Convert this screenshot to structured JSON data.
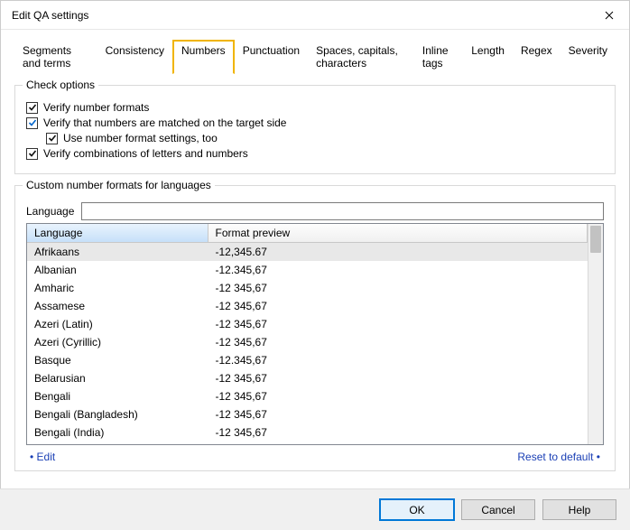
{
  "window": {
    "title": "Edit QA settings"
  },
  "tabs": {
    "items": [
      "Segments and terms",
      "Consistency",
      "Numbers",
      "Punctuation",
      "Spaces, capitals, characters",
      "Inline tags",
      "Length",
      "Regex",
      "Severity"
    ],
    "active_index": 2
  },
  "check_options": {
    "title": "Check options",
    "verify_number_formats": {
      "label": "Verify number formats",
      "checked": true,
      "color": "black"
    },
    "verify_numbers_matched": {
      "label": "Verify that numbers are matched on the target side",
      "checked": true,
      "color": "blue"
    },
    "use_number_format_settings": {
      "label": "Use number format settings, too",
      "checked": true,
      "color": "black"
    },
    "verify_letter_number_combos": {
      "label": "Verify combinations of letters and numbers",
      "checked": true,
      "color": "black"
    }
  },
  "formats_group": {
    "title": "Custom number formats for languages",
    "language_label": "Language",
    "language_value": "",
    "columns": {
      "language": "Language",
      "preview": "Format preview"
    },
    "rows": [
      {
        "language": "Afrikaans",
        "preview": "-12,345.67",
        "selected": true
      },
      {
        "language": "Albanian",
        "preview": "-12.345,67"
      },
      {
        "language": "Amharic",
        "preview": "-12 345,67"
      },
      {
        "language": "Assamese",
        "preview": "-12 345,67"
      },
      {
        "language": "Azeri (Latin)",
        "preview": "-12 345,67"
      },
      {
        "language": "Azeri (Cyrillic)",
        "preview": "-12 345,67"
      },
      {
        "language": "Basque",
        "preview": "-12.345,67"
      },
      {
        "language": "Belarusian",
        "preview": "-12 345,67"
      },
      {
        "language": "Bengali",
        "preview": "-12 345,67"
      },
      {
        "language": "Bengali (Bangladesh)",
        "preview": "-12 345,67"
      },
      {
        "language": "Bengali (India)",
        "preview": "-12 345,67"
      }
    ],
    "edit_link": "Edit",
    "reset_link": "Reset to default"
  },
  "buttons": {
    "ok": "OK",
    "cancel": "Cancel",
    "help": "Help"
  }
}
